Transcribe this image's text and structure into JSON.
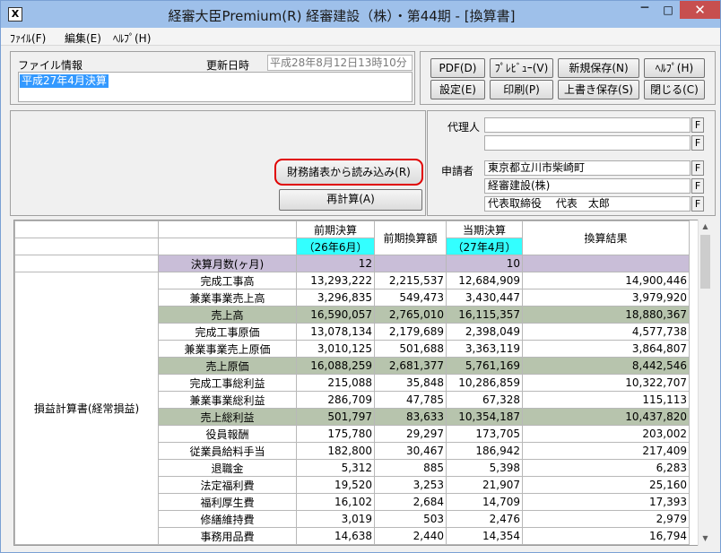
{
  "window": {
    "title": "経審大臣Premium(R)  経審建設（株）・第44期 - [換算書]",
    "app_icon": "X",
    "minimize": "─",
    "maximize": "□",
    "close": "✕"
  },
  "menu": [
    {
      "label": "ﾌｧｲﾙ(F)"
    },
    {
      "label": "編集(E)"
    },
    {
      "label": "ﾍﾙﾌﾟ(H)"
    }
  ],
  "file_info": {
    "label": "ファイル情報",
    "updated_label": "更新日時",
    "updated_value": "平成28年8月12日13時10分",
    "file_value": "平成27年4月決算"
  },
  "toolbar": {
    "pdf": "PDF(D)",
    "preview": "ﾌﾟﾚﾋﾞｭｰ(V)",
    "save_new": "新規保存(N)",
    "help": "ﾍﾙﾌﾟ(H)",
    "settings": "設定(E)",
    "print": "印刷(P)",
    "overwrite": "上書き保存(S)",
    "close": "閉じる(C)"
  },
  "actions": {
    "import": "財務諸表から読み込み(R)",
    "recalc": "再計算(A)"
  },
  "agent": {
    "label": "代理人",
    "line1": "",
    "line2": ""
  },
  "applicant": {
    "label": "申請者",
    "address": "東京都立川市柴崎町",
    "company": "経審建設(株)",
    "representative": "代表取締役　 代表　太郎"
  },
  "f_button": "F",
  "table": {
    "headers": {
      "prev": "前期決算",
      "prev_period": "（26年6月）",
      "prev_conv": "前期換算額",
      "curr": "当期決算",
      "curr_period": "（27年4月）",
      "result": "換算結果"
    },
    "months_label": "決算月数(ヶ月)",
    "months_prev": "12",
    "months_curr": "10",
    "group_label": "損益計算書(経常損益)",
    "rows": [
      {
        "name": "完成工事高",
        "prev": "13,293,222",
        "conv": "2,215,537",
        "curr": "12,684,909",
        "result": "14,900,446",
        "hl": false
      },
      {
        "name": "兼業事業売上高",
        "prev": "3,296,835",
        "conv": "549,473",
        "curr": "3,430,447",
        "result": "3,979,920",
        "hl": false
      },
      {
        "name": "売上高",
        "prev": "16,590,057",
        "conv": "2,765,010",
        "curr": "16,115,357",
        "result": "18,880,367",
        "hl": true
      },
      {
        "name": "完成工事原価",
        "prev": "13,078,134",
        "conv": "2,179,689",
        "curr": "2,398,049",
        "result": "4,577,738",
        "hl": false
      },
      {
        "name": "兼業事業売上原価",
        "prev": "3,010,125",
        "conv": "501,688",
        "curr": "3,363,119",
        "result": "3,864,807",
        "hl": false
      },
      {
        "name": "売上原価",
        "prev": "16,088,259",
        "conv": "2,681,377",
        "curr": "5,761,169",
        "result": "8,442,546",
        "hl": true
      },
      {
        "name": "完成工事総利益",
        "prev": "215,088",
        "conv": "35,848",
        "curr": "10,286,859",
        "result": "10,322,707",
        "hl": false
      },
      {
        "name": "兼業事業総利益",
        "prev": "286,709",
        "conv": "47,785",
        "curr": "67,328",
        "result": "115,113",
        "hl": false
      },
      {
        "name": "売上総利益",
        "prev": "501,797",
        "conv": "83,633",
        "curr": "10,354,187",
        "result": "10,437,820",
        "hl": true
      },
      {
        "name": "役員報酬",
        "prev": "175,780",
        "conv": "29,297",
        "curr": "173,705",
        "result": "203,002",
        "hl": false
      },
      {
        "name": "従業員給料手当",
        "prev": "182,800",
        "conv": "30,467",
        "curr": "186,942",
        "result": "217,409",
        "hl": false
      },
      {
        "name": "退職金",
        "prev": "5,312",
        "conv": "885",
        "curr": "5,398",
        "result": "6,283",
        "hl": false
      },
      {
        "name": "法定福利費",
        "prev": "19,520",
        "conv": "3,253",
        "curr": "21,907",
        "result": "25,160",
        "hl": false
      },
      {
        "name": "福利厚生費",
        "prev": "16,102",
        "conv": "2,684",
        "curr": "14,709",
        "result": "17,393",
        "hl": false
      },
      {
        "name": "修繕維持費",
        "prev": "3,019",
        "conv": "503",
        "curr": "2,476",
        "result": "2,979",
        "hl": false
      },
      {
        "name": "事務用品費",
        "prev": "14,638",
        "conv": "2,440",
        "curr": "14,354",
        "result": "16,794",
        "hl": false
      }
    ]
  },
  "scrollbar": {
    "up": "▲",
    "down": "▼"
  }
}
